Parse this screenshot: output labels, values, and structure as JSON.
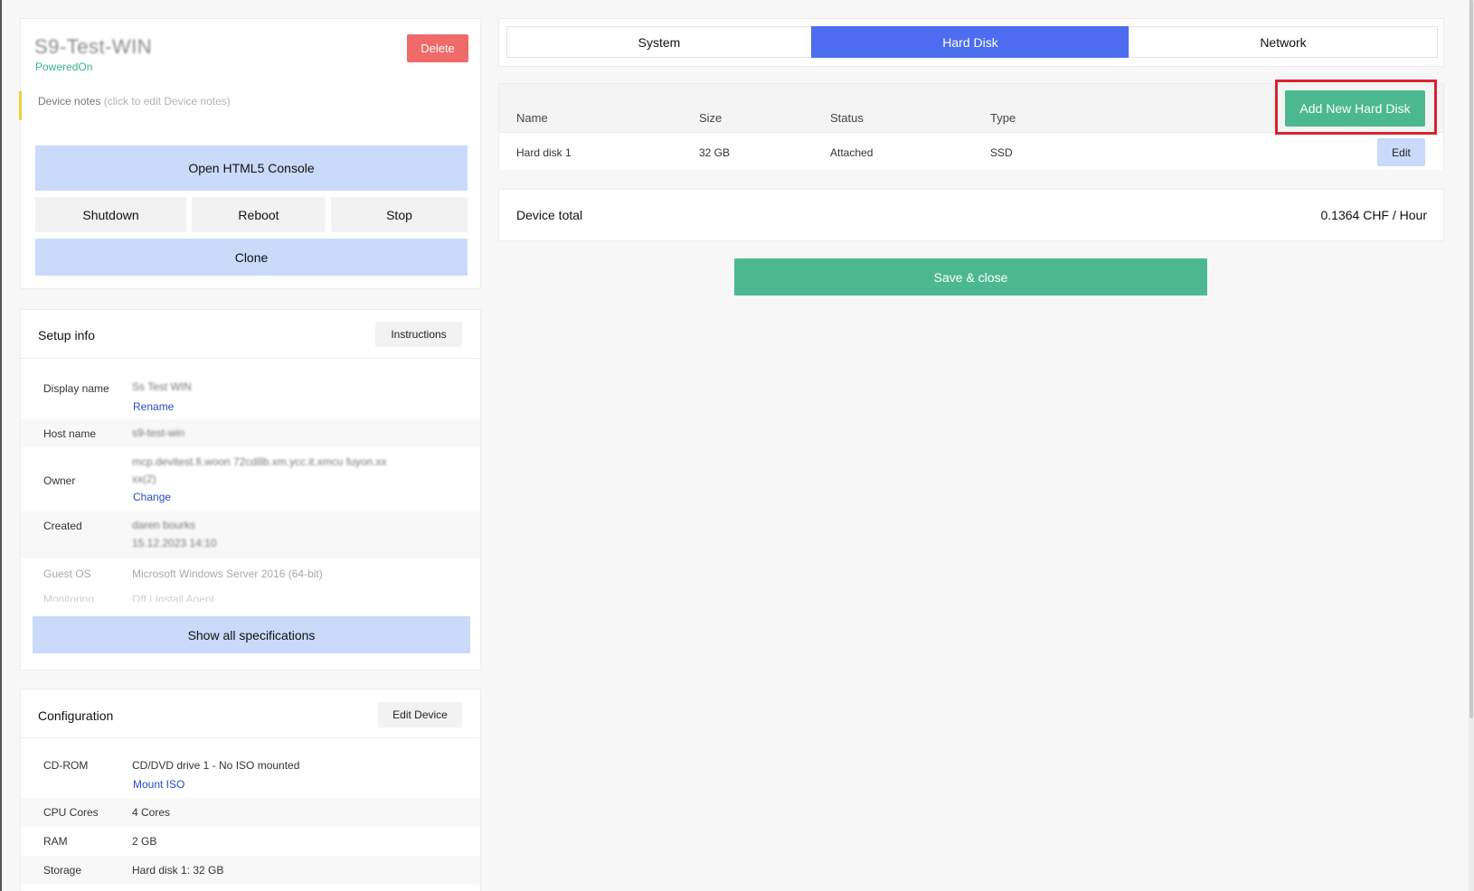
{
  "device": {
    "name": "S9-Test-WIN",
    "status": "PoweredOn",
    "delete_label": "Delete",
    "notes_label": "Device notes",
    "notes_hint": "(click to edit Device notes)",
    "console_label": "Open HTML5 Console",
    "shutdown_label": "Shutdown",
    "reboot_label": "Reboot",
    "stop_label": "Stop",
    "clone_label": "Clone"
  },
  "setup": {
    "title": "Setup info",
    "instructions_label": "Instructions",
    "display_name_label": "Display name",
    "display_name_value": "Ss Test WIN",
    "rename_label": "Rename",
    "host_name_label": "Host name",
    "host_name_value": "s9-test-win",
    "owner_label": "Owner",
    "owner_value_line1": "mcp.devitest.fi.woon 72cd8b.xm.ycc.it.xmcu fuyon.xx",
    "owner_value_line2": "xx(2)",
    "change_label": "Change",
    "created_label": "Created",
    "created_value_line1": "daren bourks",
    "created_value_line2": "15.12.2023 14:10",
    "guest_os_label": "Guest OS",
    "guest_os_value": "Microsoft Windows Server 2016 (64-bit)",
    "monitoring_label": "Monitoring",
    "monitoring_value": "Off | Install Agent",
    "show_all_label": "Show all specifications"
  },
  "config": {
    "title": "Configuration",
    "edit_device_label": "Edit Device",
    "cdrom_label": "CD-ROM",
    "cdrom_value": "CD/DVD drive 1 - No ISO mounted",
    "mount_iso_label": "Mount ISO",
    "cpu_label": "CPU Cores",
    "cpu_value": "4 Cores",
    "ram_label": "RAM",
    "ram_value": "2 GB",
    "storage_label": "Storage",
    "storage_value": "Hard disk 1: 32 GB"
  },
  "tabs": {
    "system": "System",
    "hard_disk": "Hard Disk",
    "network": "Network",
    "active": "Hard Disk"
  },
  "disks": {
    "add_label": "Add New Hard Disk",
    "columns": {
      "name": "Name",
      "size": "Size",
      "status": "Status",
      "type": "Type"
    },
    "rows": [
      {
        "name": "Hard disk 1",
        "size": "32 GB",
        "status": "Attached",
        "type": "SSD",
        "edit_label": "Edit"
      }
    ]
  },
  "total": {
    "label": "Device total",
    "value": "0.1364 CHF / Hour"
  },
  "save_label": "Save & close",
  "colors": {
    "accent_blue": "#4d6cf0",
    "light_blue": "#c9dafa",
    "green": "#4cb892",
    "danger": "#f06a6a",
    "highlight": "#d9232e",
    "note_yellow": "#f2cf3d"
  }
}
